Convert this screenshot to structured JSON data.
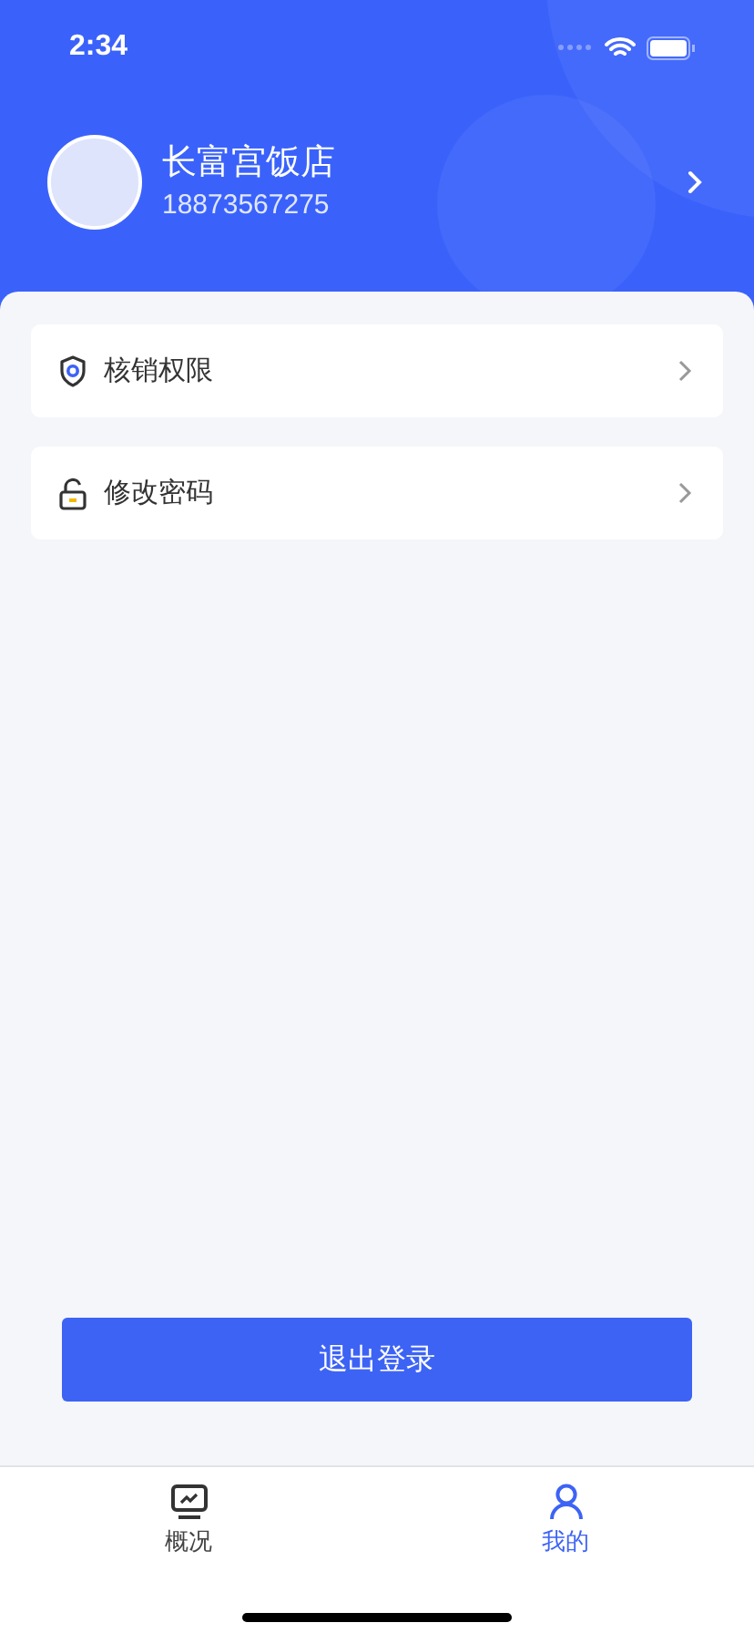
{
  "status_bar": {
    "time": "2:34"
  },
  "profile": {
    "name": "长富宫饭店",
    "phone": "18873567275"
  },
  "menu": [
    {
      "kind": "shield",
      "label": "核销权限"
    },
    {
      "kind": "lock",
      "label": "修改密码"
    }
  ],
  "logout_button": "退出登录",
  "tabs": [
    {
      "kind": "chart",
      "label": "概况",
      "selected": false
    },
    {
      "kind": "person",
      "label": "我的",
      "selected": true
    }
  ]
}
